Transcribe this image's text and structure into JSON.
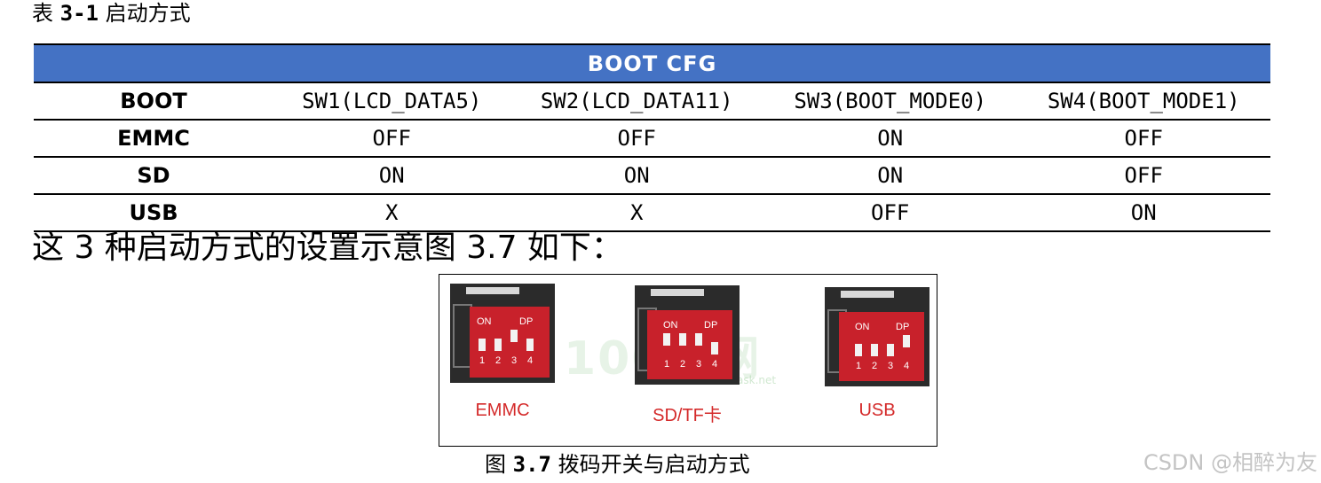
{
  "table_caption": {
    "prefix": "表",
    "number": "3-1",
    "title": "启动方式"
  },
  "table": {
    "band_title": "BOOT CFG",
    "header": [
      "BOOT",
      "SW1(LCD_DATA5)",
      "SW2(LCD_DATA11)",
      "SW3(BOOT_MODE0)",
      "SW4(BOOT_MODE1)"
    ],
    "rows": [
      {
        "label": "EMMC",
        "values": [
          "OFF",
          "OFF",
          "ON",
          "OFF"
        ]
      },
      {
        "label": "SD",
        "values": [
          "ON",
          "ON",
          "ON",
          "OFF"
        ]
      },
      {
        "label": "USB",
        "values": [
          "X",
          "X",
          "OFF",
          "ON"
        ]
      }
    ]
  },
  "sentence": "这 3 种启动方式的设置示意图 3.7 如下：",
  "figure": {
    "watermark": "100问网",
    "watermark_url": "www.100ask.net",
    "switches": [
      {
        "label": "EMMC",
        "on_text": "ON",
        "dp_text": "DP",
        "numbers": [
          "1",
          "2",
          "3",
          "4"
        ]
      },
      {
        "label": "SD/TF卡",
        "on_text": "ON",
        "dp_text": "DP",
        "numbers": [
          "1",
          "2",
          "3",
          "4"
        ]
      },
      {
        "label": "USB",
        "on_text": "ON",
        "dp_text": "DP",
        "numbers": [
          "1",
          "2",
          "3",
          "4"
        ]
      }
    ]
  },
  "figure_caption": {
    "prefix": "图",
    "number": "3.7",
    "title": "拨码开关与启动方式"
  },
  "corner_watermark": "CSDN @相醉为友",
  "colors": {
    "band": "#4472c4",
    "switch_red": "#d42a2a",
    "pcb_dark": "#2b2b2b"
  }
}
